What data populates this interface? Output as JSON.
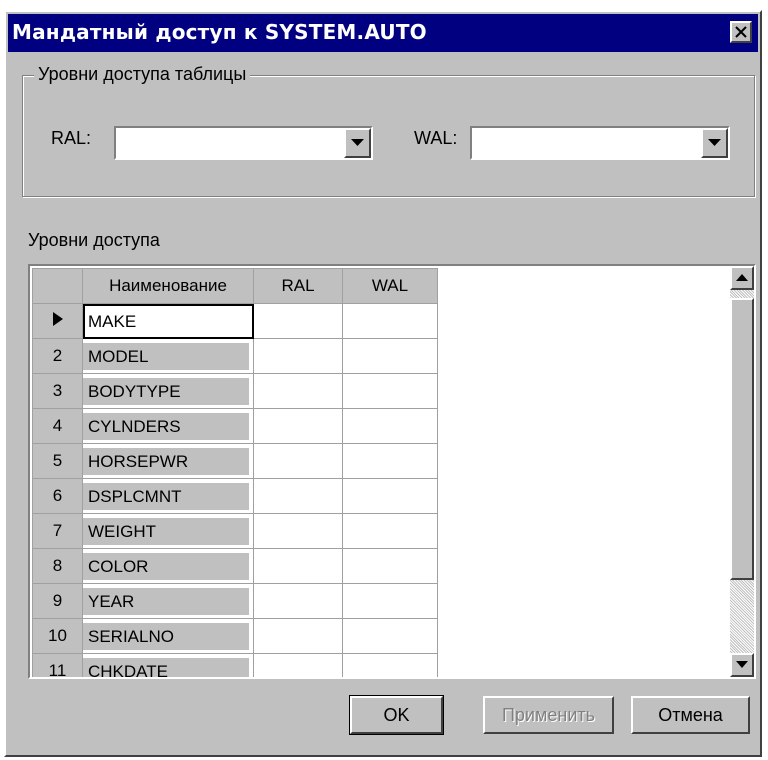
{
  "window": {
    "title": "Мандатный доступ к SYSTEM.AUTO"
  },
  "table_levels": {
    "group_label": "Уровни доступа таблицы",
    "ral_label": "RAL:",
    "ral_value": "",
    "wal_label": "WAL:",
    "wal_value": ""
  },
  "levels": {
    "section_label": "Уровни доступа",
    "columns": [
      "Наименование",
      "RAL",
      "WAL"
    ],
    "rows": [
      {
        "num": "",
        "name": "MAKE",
        "ral": "",
        "wal": ""
      },
      {
        "num": "2",
        "name": "MODEL",
        "ral": "",
        "wal": ""
      },
      {
        "num": "3",
        "name": "BODYTYPE",
        "ral": "",
        "wal": ""
      },
      {
        "num": "4",
        "name": "CYLNDERS",
        "ral": "",
        "wal": ""
      },
      {
        "num": "5",
        "name": "HORSEPWR",
        "ral": "",
        "wal": ""
      },
      {
        "num": "6",
        "name": "DSPLCMNT",
        "ral": "",
        "wal": ""
      },
      {
        "num": "7",
        "name": "WEIGHT",
        "ral": "",
        "wal": ""
      },
      {
        "num": "8",
        "name": "COLOR",
        "ral": "",
        "wal": ""
      },
      {
        "num": "9",
        "name": "YEAR",
        "ral": "",
        "wal": ""
      },
      {
        "num": "10",
        "name": "SERIALNO",
        "ral": "",
        "wal": ""
      },
      {
        "num": "11",
        "name": "CHKDATE",
        "ral": "",
        "wal": ""
      }
    ]
  },
  "buttons": {
    "ok": "OK",
    "apply": "Применить",
    "cancel": "Отмена"
  },
  "colors": {
    "titlebar": "#000080",
    "face": "#c0c0c0"
  }
}
